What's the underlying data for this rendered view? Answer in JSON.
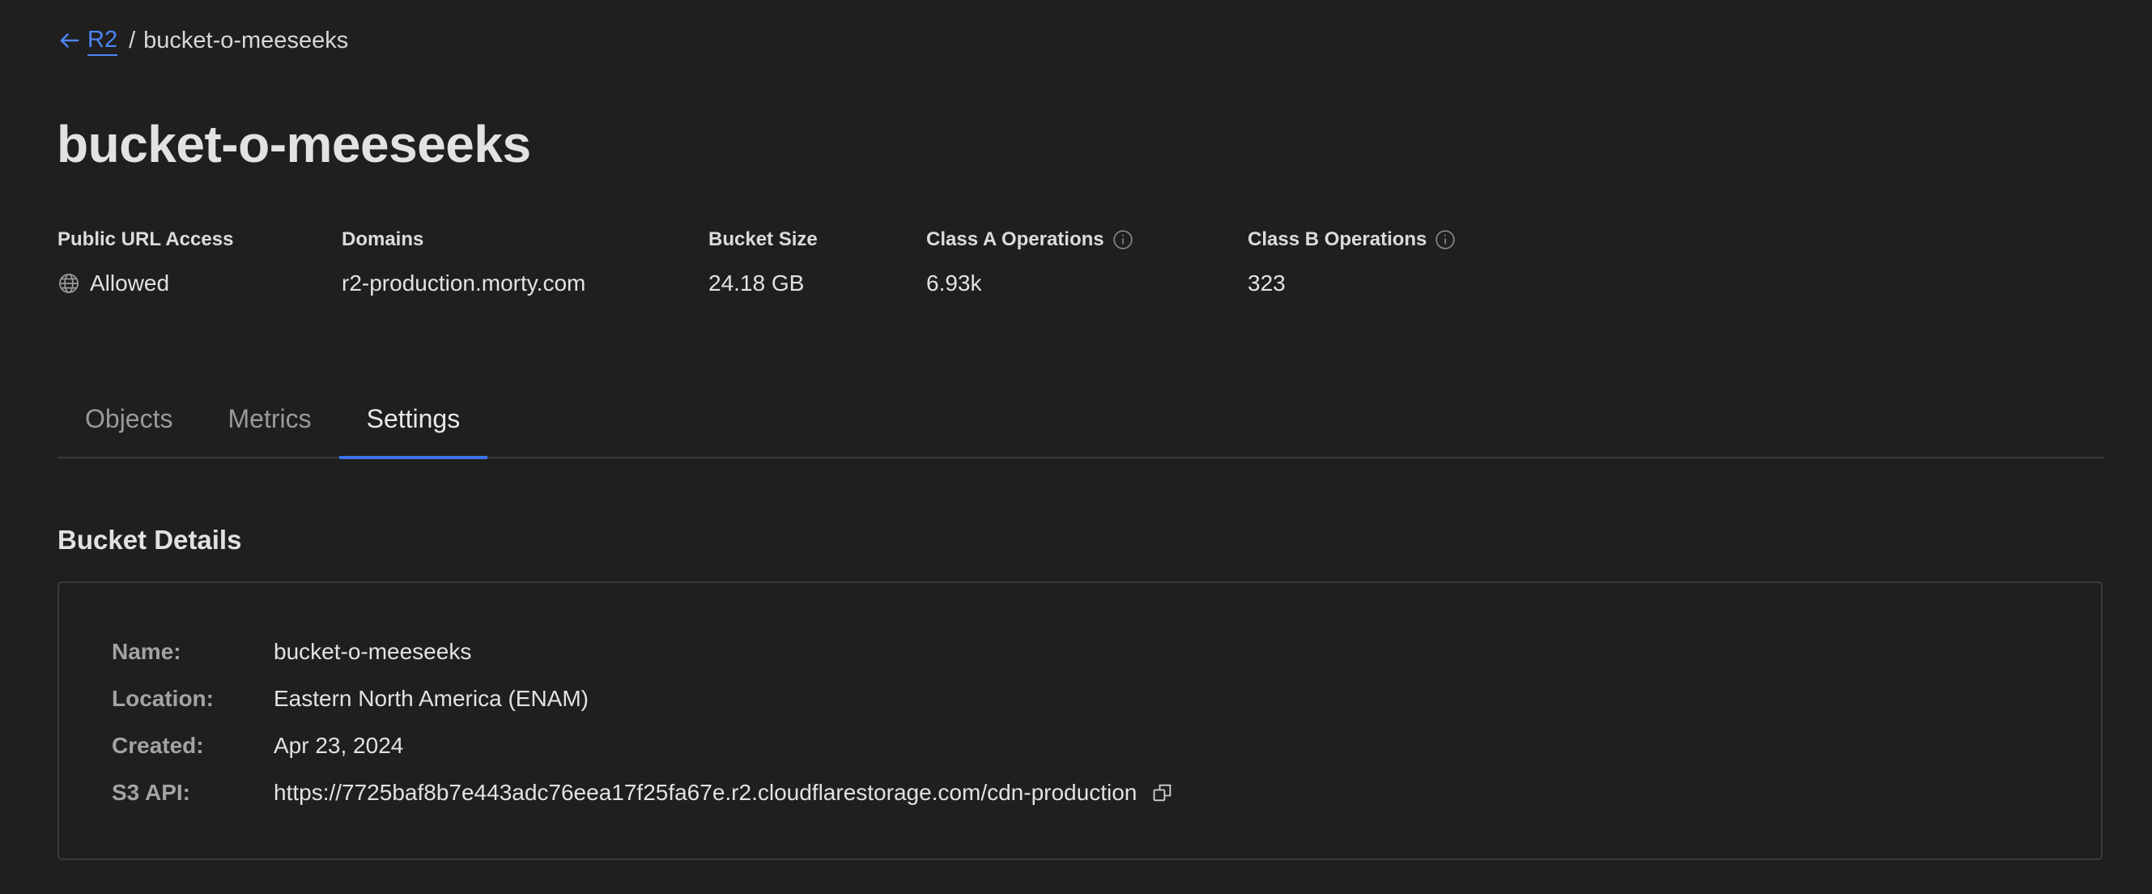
{
  "breadcrumb": {
    "parent_label": "R2",
    "separator": "/",
    "current_label": "bucket-o-meeseeks"
  },
  "page_title": "bucket-o-meeseeks",
  "stats": {
    "public_url_access": {
      "label": "Public URL Access",
      "value": "Allowed",
      "icon": "globe-icon"
    },
    "domains": {
      "label": "Domains",
      "value": "r2-production.morty.com"
    },
    "bucket_size": {
      "label": "Bucket Size",
      "value": "24.18 GB"
    },
    "class_a": {
      "label": "Class A Operations",
      "value": "6.93k",
      "icon": "info-icon"
    },
    "class_b": {
      "label": "Class B Operations",
      "value": "323",
      "icon": "info-icon"
    }
  },
  "tabs": [
    {
      "label": "Objects",
      "active": false
    },
    {
      "label": "Metrics",
      "active": false
    },
    {
      "label": "Settings",
      "active": true
    }
  ],
  "bucket_details": {
    "title": "Bucket Details",
    "name": {
      "label": "Name:",
      "value": "bucket-o-meeseeks"
    },
    "location": {
      "label": "Location:",
      "value": "Eastern North America (ENAM)"
    },
    "created": {
      "label": "Created:",
      "value": "Apr 23, 2024"
    },
    "s3_api": {
      "label": "S3 API:",
      "value": "https://7725baf8b7e443adc76eea17f25fa67e.r2.cloudflarestorage.com/cdn-production",
      "icon": "copy-icon"
    }
  },
  "colors": {
    "background": "#1f1f1f",
    "accent": "#3b73e6",
    "link": "#4d85f5",
    "border": "#3a3a3a"
  }
}
